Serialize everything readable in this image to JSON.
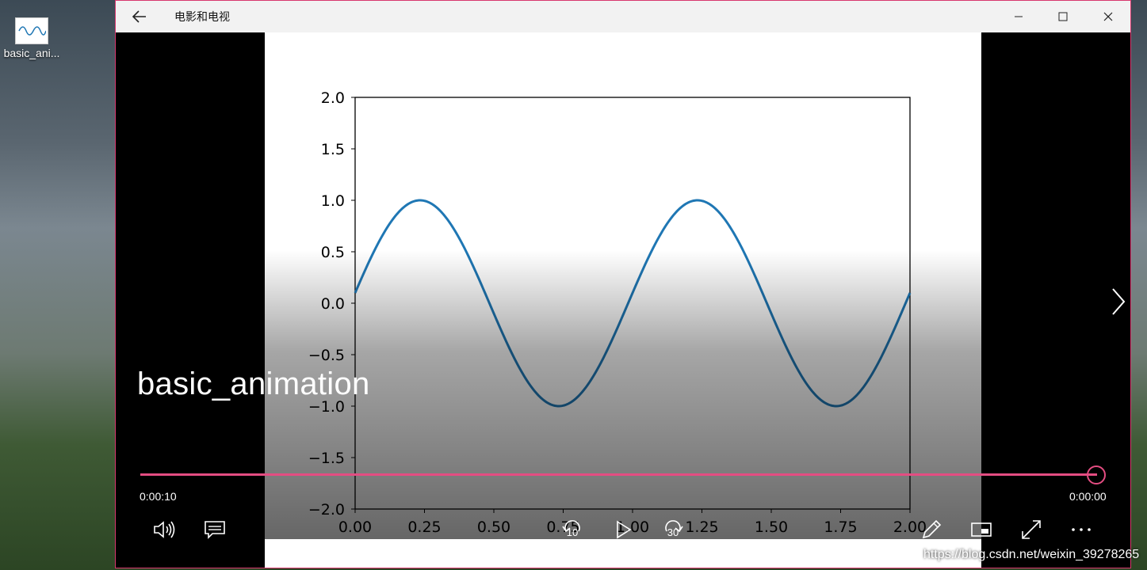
{
  "desktop": {
    "icon_label": "basic_ani..."
  },
  "window": {
    "app_title": "电影和电视",
    "back_icon": "back-arrow-icon",
    "minimize_icon": "minimize-icon",
    "maximize_icon": "maximize-icon",
    "close_icon": "close-icon"
  },
  "player": {
    "video_title": "basic_animation",
    "time_elapsed": "0:00:10",
    "time_remaining": "0:00:00",
    "progress": 1.0,
    "skip_back_label": "10",
    "skip_forward_label": "30",
    "accent_color": "#e44d82"
  },
  "watermark": "https://blog.csdn.net/weixin_39278265",
  "chart_data": {
    "type": "line",
    "function": "sin(2*pi*x + phase)",
    "x": [
      0.0,
      0.125,
      0.25,
      0.375,
      0.5,
      0.625,
      0.75,
      0.875,
      1.0,
      1.125,
      1.25,
      1.375,
      1.5,
      1.625,
      1.75,
      1.875,
      2.0
    ],
    "series": [
      {
        "values": [
          0.1,
          0.77,
          1.0,
          0.63,
          -0.1,
          -0.77,
          -1.0,
          -0.63,
          0.1,
          0.77,
          1.0,
          0.63,
          -0.1,
          -0.77,
          -1.0,
          -0.63,
          0.1
        ]
      }
    ],
    "xlim": [
      0,
      2
    ],
    "ylim": [
      -2,
      2
    ],
    "xticks": [
      "0.00",
      "0.25",
      "0.50",
      "0.75",
      "1.00",
      "1.25",
      "1.50",
      "1.75",
      "2.00"
    ],
    "yticks": [
      "2.0",
      "1.5",
      "1.0",
      "0.5",
      "0.0",
      "−0.5",
      "−1.0",
      "−1.5",
      "−2.0"
    ],
    "line_color": "#1f77b4",
    "grid": false
  }
}
